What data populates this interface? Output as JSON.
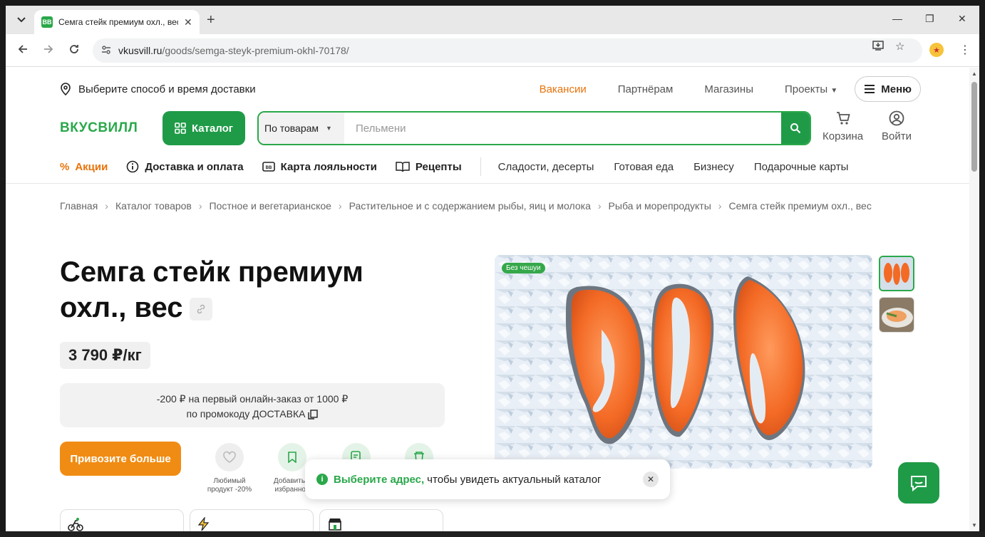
{
  "browser": {
    "tab_title": "Семга стейк премиум охл., вес",
    "favicon_text": "ВВ",
    "url_host": "vkusvill.ru",
    "url_path": "/goods/semga-steyk-premium-okhl-70178/"
  },
  "topbar": {
    "delivery": "Выберите способ и время доставки",
    "links": [
      "Вакансии",
      "Партнёрам",
      "Магазины",
      "Проекты"
    ],
    "menu": "Меню"
  },
  "header": {
    "logo": "ВКУСВИЛЛ",
    "catalog": "Каталог",
    "search_scope": "По товарам",
    "search_placeholder": "Пельмени",
    "cart": "Корзина",
    "login": "Войти"
  },
  "catnav": {
    "promo": "Акции",
    "delivery": "Доставка и оплата",
    "loyalty": "Карта лояльности",
    "recipes": "Рецепты",
    "sweets": "Сладости, десерты",
    "ready": "Готовая еда",
    "business": "Бизнесу",
    "giftcards": "Подарочные карты"
  },
  "breadcrumb": [
    "Главная",
    "Каталог товаров",
    "Постное и вегетарианское",
    "Растительное и с содержанием рыбы, яиц и молока",
    "Рыба и морепродукты",
    "Семга стейк премиум охл., вес"
  ],
  "product": {
    "title": "Семга стейк премиум охл., вес",
    "price": "3 790 ₽/кг",
    "promo_line1": "-200 ₽ на первый онлайн-заказ от 1000 ₽",
    "promo_line2_prefix": "по промокоду ",
    "promo_code": "ДОСТАВКА",
    "cta": "Привозите больше",
    "actions": [
      {
        "label": "Любимый продукт -20%",
        "color": "#eeeeee"
      },
      {
        "label": "Добавить в избранное",
        "color": "#e4f3e8"
      },
      {
        "label": "",
        "color": "#e4f3e8"
      },
      {
        "label": "",
        "color": "#e4f3e8"
      }
    ],
    "image_badge": "Без чешуи"
  },
  "toast": {
    "highlight": "Выберите адрес,",
    "text": "чтобы увидеть актуальный каталог"
  },
  "colors": {
    "brand_green": "#1f9b47",
    "accent_orange": "#f08c13",
    "promo_orange": "#e8730b"
  }
}
